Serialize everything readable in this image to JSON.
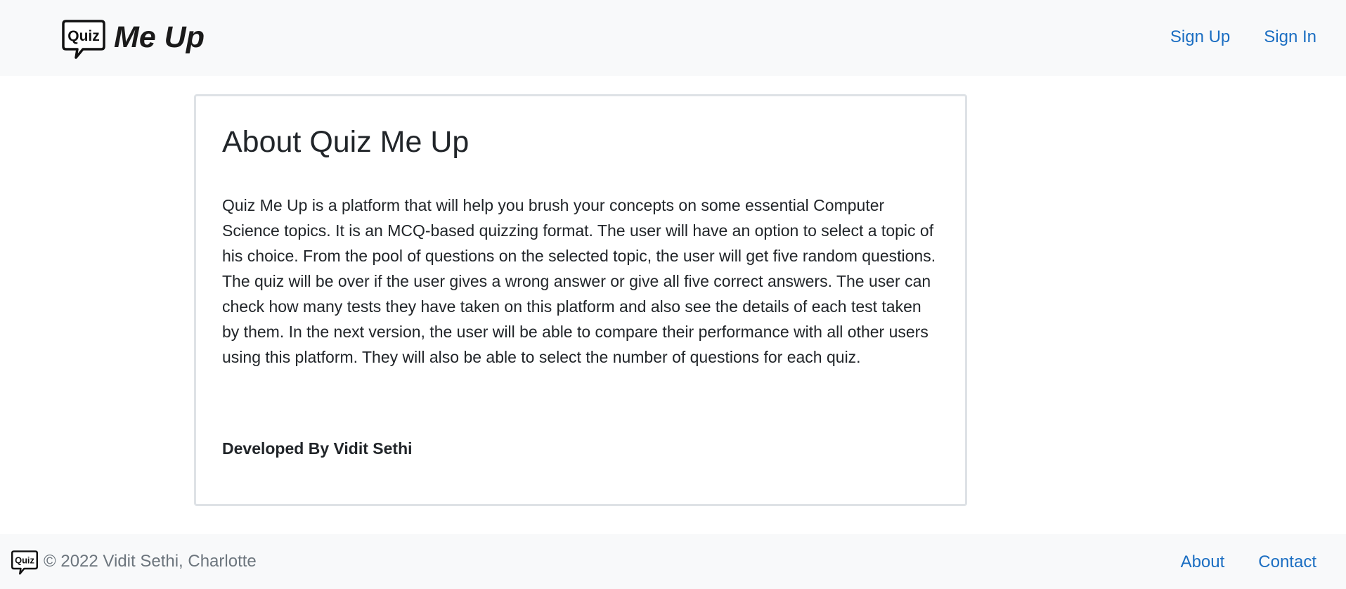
{
  "header": {
    "logo_icon": "quiz-speech-bubble-icon",
    "logo_badge_text": "Quiz",
    "brand_text": "Me Up",
    "nav": [
      {
        "label": "Sign Up"
      },
      {
        "label": "Sign In"
      }
    ]
  },
  "about": {
    "title": "About Quiz Me Up",
    "description": "Quiz Me Up is a platform that will help you brush your concepts on some essential Computer Science topics. It is an MCQ-based quizzing format. The user will have an option to select a topic of his choice. From the pool of questions on the selected topic, the user will get five random questions. The quiz will be over if the user gives a wrong answer or give all five correct answers. The user can check how many tests they have taken on this platform and also see the details of each test taken by them. In the next version, the user will be able to compare their performance with all other users using this platform. They will also be able to select the number of questions for each quiz.",
    "developer": "Developed By Vidit Sethi"
  },
  "footer": {
    "logo_icon": "quiz-speech-bubble-icon",
    "logo_badge_text": "Quiz",
    "copyright": "© 2022 Vidit Sethi, Charlotte",
    "links": [
      {
        "label": "About"
      },
      {
        "label": "Contact"
      }
    ]
  },
  "colors": {
    "link": "#1b6ec2",
    "bar_background": "#f8f9fa",
    "card_border": "#dee2e6",
    "muted_text": "#6c757d"
  }
}
